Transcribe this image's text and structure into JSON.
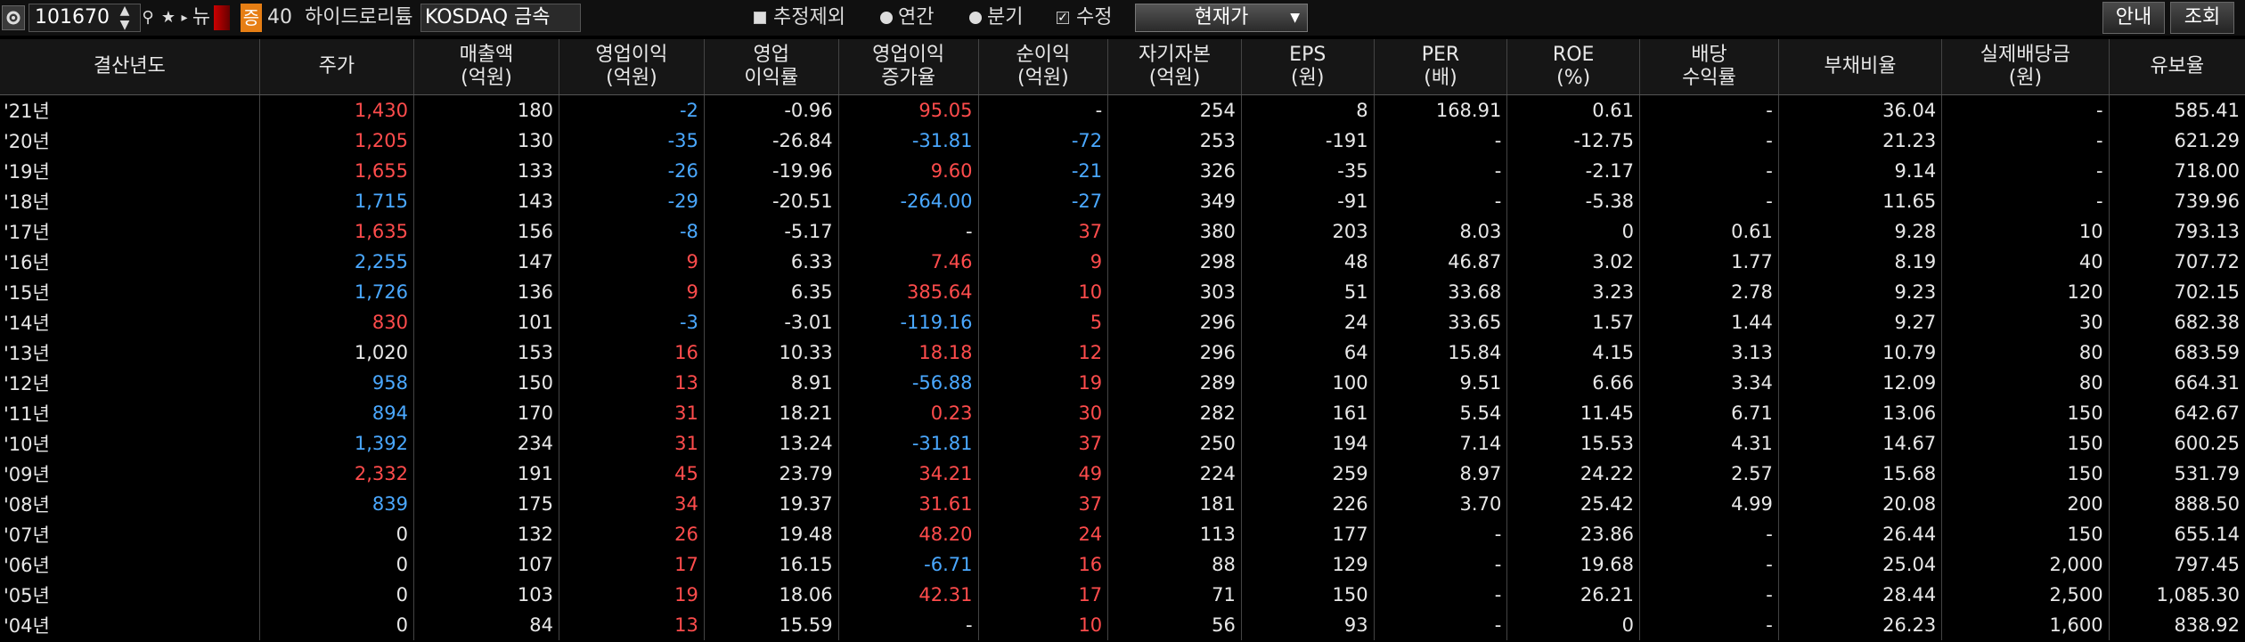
{
  "toolbar": {
    "code": "101670",
    "news_label": "뉴",
    "badge_label": "증",
    "badge_value": "40",
    "company_name": "하이드로리튬",
    "market": "KOSDAQ 금속",
    "options": [
      {
        "label": "추정제외",
        "type": "checkbox",
        "checked": false
      },
      {
        "label": "연간",
        "type": "radio",
        "checked": true
      },
      {
        "label": "분기",
        "type": "radio",
        "checked": false
      },
      {
        "label": "수정",
        "type": "checkbox",
        "checked": true
      }
    ],
    "price_basis": "현재가",
    "guide_label": "안내",
    "query_label": "조회"
  },
  "colors": {
    "positive": "#ff4c4c",
    "negative": "#4aa8ff",
    "neutral": "#e8e8e8",
    "accent": "#e67e14"
  },
  "table": {
    "headers": [
      "결산년도",
      "주가",
      "매출액\n(억원)",
      "영업이익\n(억원)",
      "영업\n이익률",
      "영업이익\n증가율",
      "순이익\n(억원)",
      "자기자본\n(억원)",
      "EPS\n(원)",
      "PER\n(배)",
      "ROE\n(%)",
      "배당\n수익률",
      "부채비율",
      "실제배당금\n(원)",
      "유보율"
    ],
    "rows": [
      {
        "cells": [
          "'21년",
          "1,430",
          "180",
          "-2",
          "-0.96",
          "95.05",
          "-",
          "254",
          "8",
          "168.91",
          "0.61",
          "-",
          "36.04",
          "-",
          "585.41"
        ],
        "colors": [
          "w",
          "r",
          "w",
          "b",
          "w",
          "r",
          "w",
          "w",
          "w",
          "w",
          "w",
          "w",
          "w",
          "w",
          "w"
        ]
      },
      {
        "cells": [
          "'20년",
          "1,205",
          "130",
          "-35",
          "-26.84",
          "-31.81",
          "-72",
          "253",
          "-191",
          "-",
          "-12.75",
          "-",
          "21.23",
          "-",
          "621.29"
        ],
        "colors": [
          "w",
          "r",
          "w",
          "b",
          "w",
          "b",
          "b",
          "w",
          "w",
          "w",
          "w",
          "w",
          "w",
          "w",
          "w"
        ]
      },
      {
        "cells": [
          "'19년",
          "1,655",
          "133",
          "-26",
          "-19.96",
          "9.60",
          "-21",
          "326",
          "-35",
          "-",
          "-2.17",
          "-",
          "9.14",
          "-",
          "718.00"
        ],
        "colors": [
          "w",
          "r",
          "w",
          "b",
          "w",
          "r",
          "b",
          "w",
          "w",
          "w",
          "w",
          "w",
          "w",
          "w",
          "w"
        ]
      },
      {
        "cells": [
          "'18년",
          "1,715",
          "143",
          "-29",
          "-20.51",
          "-264.00",
          "-27",
          "349",
          "-91",
          "-",
          "-5.38",
          "-",
          "11.65",
          "-",
          "739.96"
        ],
        "colors": [
          "w",
          "b",
          "w",
          "b",
          "w",
          "b",
          "b",
          "w",
          "w",
          "w",
          "w",
          "w",
          "w",
          "w",
          "w"
        ]
      },
      {
        "cells": [
          "'17년",
          "1,635",
          "156",
          "-8",
          "-5.17",
          "-",
          "37",
          "380",
          "203",
          "8.03",
          "0",
          "0.61",
          "9.28",
          "10",
          "793.13"
        ],
        "colors": [
          "w",
          "r",
          "w",
          "b",
          "w",
          "w",
          "r",
          "w",
          "w",
          "w",
          "w",
          "w",
          "w",
          "w",
          "w"
        ]
      },
      {
        "cells": [
          "'16년",
          "2,255",
          "147",
          "9",
          "6.33",
          "7.46",
          "9",
          "298",
          "48",
          "46.87",
          "3.02",
          "1.77",
          "8.19",
          "40",
          "707.72"
        ],
        "colors": [
          "w",
          "b",
          "w",
          "r",
          "w",
          "r",
          "r",
          "w",
          "w",
          "w",
          "w",
          "w",
          "w",
          "w",
          "w"
        ]
      },
      {
        "cells": [
          "'15년",
          "1,726",
          "136",
          "9",
          "6.35",
          "385.64",
          "10",
          "303",
          "51",
          "33.68",
          "3.23",
          "2.78",
          "9.23",
          "120",
          "702.15"
        ],
        "colors": [
          "w",
          "b",
          "w",
          "r",
          "w",
          "r",
          "r",
          "w",
          "w",
          "w",
          "w",
          "w",
          "w",
          "w",
          "w"
        ]
      },
      {
        "cells": [
          "'14년",
          "830",
          "101",
          "-3",
          "-3.01",
          "-119.16",
          "5",
          "296",
          "24",
          "33.65",
          "1.57",
          "1.44",
          "9.27",
          "30",
          "682.38"
        ],
        "colors": [
          "w",
          "r",
          "w",
          "b",
          "w",
          "b",
          "r",
          "w",
          "w",
          "w",
          "w",
          "w",
          "w",
          "w",
          "w"
        ]
      },
      {
        "cells": [
          "'13년",
          "1,020",
          "153",
          "16",
          "10.33",
          "18.18",
          "12",
          "296",
          "64",
          "15.84",
          "4.15",
          "3.13",
          "10.79",
          "80",
          "683.59"
        ],
        "colors": [
          "w",
          "w",
          "w",
          "r",
          "w",
          "r",
          "r",
          "w",
          "w",
          "w",
          "w",
          "w",
          "w",
          "w",
          "w"
        ]
      },
      {
        "cells": [
          "'12년",
          "958",
          "150",
          "13",
          "8.91",
          "-56.88",
          "19",
          "289",
          "100",
          "9.51",
          "6.66",
          "3.34",
          "12.09",
          "80",
          "664.31"
        ],
        "colors": [
          "w",
          "b",
          "w",
          "r",
          "w",
          "b",
          "r",
          "w",
          "w",
          "w",
          "w",
          "w",
          "w",
          "w",
          "w"
        ]
      },
      {
        "cells": [
          "'11년",
          "894",
          "170",
          "31",
          "18.21",
          "0.23",
          "30",
          "282",
          "161",
          "5.54",
          "11.45",
          "6.71",
          "13.06",
          "150",
          "642.67"
        ],
        "colors": [
          "w",
          "b",
          "w",
          "r",
          "w",
          "r",
          "r",
          "w",
          "w",
          "w",
          "w",
          "w",
          "w",
          "w",
          "w"
        ]
      },
      {
        "cells": [
          "'10년",
          "1,392",
          "234",
          "31",
          "13.24",
          "-31.81",
          "37",
          "250",
          "194",
          "7.14",
          "15.53",
          "4.31",
          "14.67",
          "150",
          "600.25"
        ],
        "colors": [
          "w",
          "b",
          "w",
          "r",
          "w",
          "b",
          "r",
          "w",
          "w",
          "w",
          "w",
          "w",
          "w",
          "w",
          "w"
        ]
      },
      {
        "cells": [
          "'09년",
          "2,332",
          "191",
          "45",
          "23.79",
          "34.21",
          "49",
          "224",
          "259",
          "8.97",
          "24.22",
          "2.57",
          "15.68",
          "150",
          "531.79"
        ],
        "colors": [
          "w",
          "r",
          "w",
          "r",
          "w",
          "r",
          "r",
          "w",
          "w",
          "w",
          "w",
          "w",
          "w",
          "w",
          "w"
        ]
      },
      {
        "cells": [
          "'08년",
          "839",
          "175",
          "34",
          "19.37",
          "31.61",
          "37",
          "181",
          "226",
          "3.70",
          "25.42",
          "4.99",
          "20.08",
          "200",
          "888.50"
        ],
        "colors": [
          "w",
          "b",
          "w",
          "r",
          "w",
          "r",
          "r",
          "w",
          "w",
          "w",
          "w",
          "w",
          "w",
          "w",
          "w"
        ]
      },
      {
        "cells": [
          "'07년",
          "0",
          "132",
          "26",
          "19.48",
          "48.20",
          "24",
          "113",
          "177",
          "-",
          "23.86",
          "-",
          "26.44",
          "150",
          "655.14"
        ],
        "colors": [
          "w",
          "w",
          "w",
          "r",
          "w",
          "r",
          "r",
          "w",
          "w",
          "w",
          "w",
          "w",
          "w",
          "w",
          "w"
        ]
      },
      {
        "cells": [
          "'06년",
          "0",
          "107",
          "17",
          "16.15",
          "-6.71",
          "16",
          "88",
          "129",
          "-",
          "19.68",
          "-",
          "25.04",
          "2,000",
          "797.45"
        ],
        "colors": [
          "w",
          "w",
          "w",
          "r",
          "w",
          "b",
          "r",
          "w",
          "w",
          "w",
          "w",
          "w",
          "w",
          "w",
          "w"
        ]
      },
      {
        "cells": [
          "'05년",
          "0",
          "103",
          "19",
          "18.06",
          "42.31",
          "17",
          "71",
          "150",
          "-",
          "26.21",
          "-",
          "28.44",
          "2,500",
          "1,085.30"
        ],
        "colors": [
          "w",
          "w",
          "w",
          "r",
          "w",
          "r",
          "r",
          "w",
          "w",
          "w",
          "w",
          "w",
          "w",
          "w",
          "w"
        ]
      },
      {
        "cells": [
          "'04년",
          "0",
          "84",
          "13",
          "15.59",
          "-",
          "10",
          "56",
          "93",
          "-",
          "0",
          "-",
          "26.23",
          "1,600",
          "838.92"
        ],
        "colors": [
          "w",
          "w",
          "w",
          "r",
          "w",
          "w",
          "r",
          "w",
          "w",
          "w",
          "w",
          "w",
          "w",
          "w",
          "w"
        ]
      }
    ]
  }
}
